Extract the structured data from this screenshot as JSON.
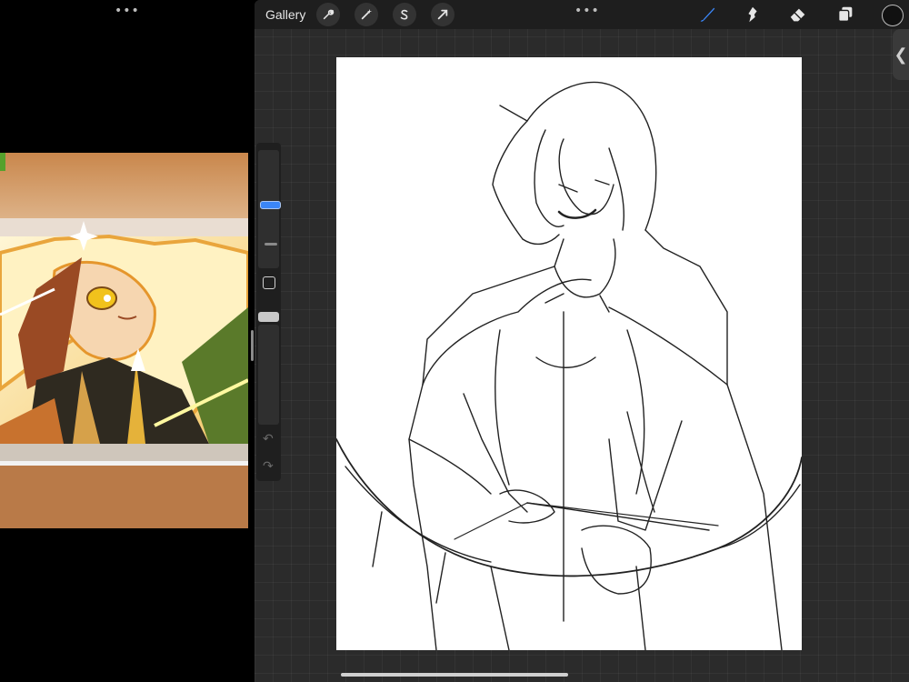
{
  "left_app": {
    "menu_dots": "•••"
  },
  "procreate": {
    "menu_dots": "•••",
    "gallery_label": "Gallery",
    "tools_left": [
      "wrench-icon",
      "magic-wand-icon",
      "selection-s-icon",
      "arrow-transform-icon"
    ],
    "tools_right": [
      "brush-icon",
      "smudge-icon",
      "eraser-icon",
      "layers-icon"
    ],
    "active_tool": "brush",
    "current_color": "#111111",
    "accent": "#3b86f7",
    "sidebar": {
      "undo": "↶",
      "redo": "↷"
    },
    "collapse_tab": "❮"
  }
}
